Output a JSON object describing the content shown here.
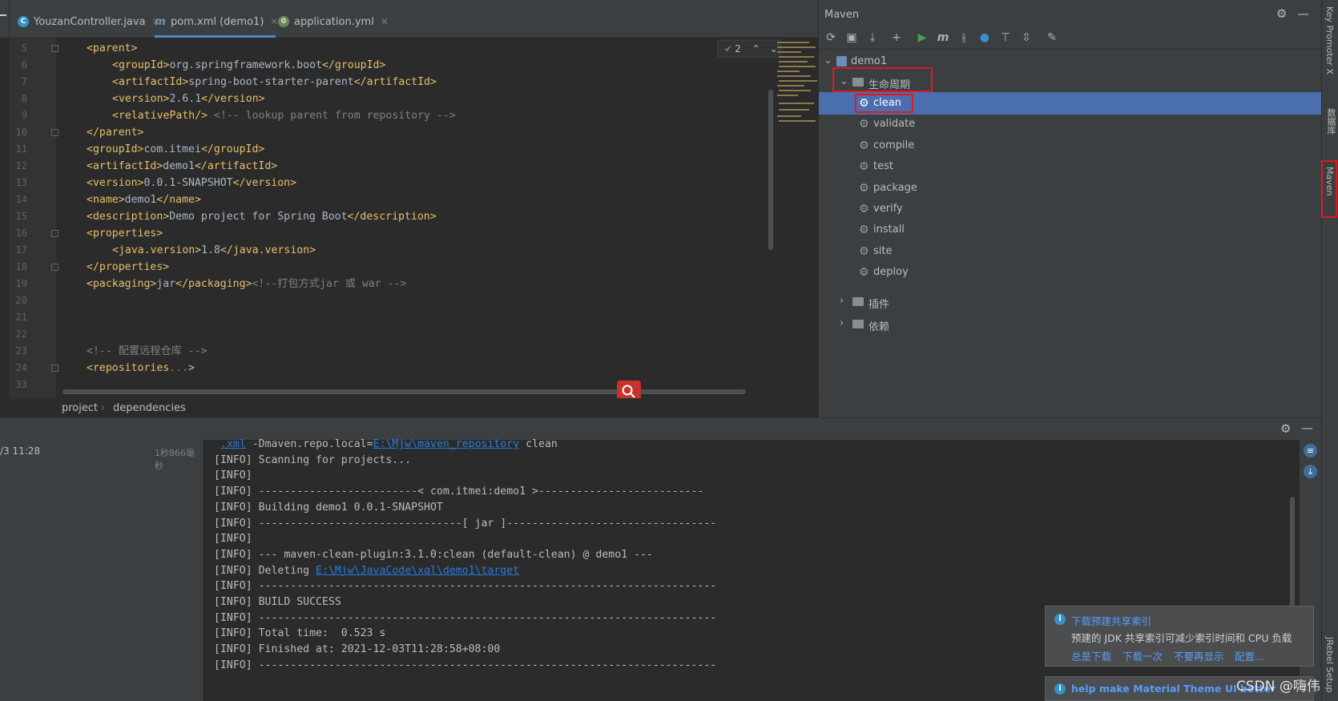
{
  "tabs": [
    {
      "label": "YouzanController.java",
      "icon": "class-icon"
    },
    {
      "label": "pom.xml (demo1)",
      "icon": "maven-file-icon"
    },
    {
      "label": "application.yml",
      "icon": "yaml-icon"
    }
  ],
  "editor": {
    "inspection_count": "2",
    "lines": [
      {
        "num": "5",
        "indent": 0,
        "parts": [
          [
            "tag",
            "<parent>"
          ]
        ]
      },
      {
        "num": "6",
        "indent": 1,
        "parts": [
          [
            "tag",
            "<groupId>"
          ],
          [
            "txt",
            "org.springframework.boot"
          ],
          [
            "tag",
            "</groupId>"
          ]
        ]
      },
      {
        "num": "7",
        "indent": 1,
        "parts": [
          [
            "tag",
            "<artifactId>"
          ],
          [
            "txt",
            "spring-boot-starter-parent"
          ],
          [
            "tag",
            "</artifactId>"
          ]
        ]
      },
      {
        "num": "8",
        "indent": 1,
        "parts": [
          [
            "tag",
            "<version>"
          ],
          [
            "txt",
            "2.6.1"
          ],
          [
            "tag",
            "</version>"
          ]
        ]
      },
      {
        "num": "9",
        "indent": 1,
        "parts": [
          [
            "tag",
            "<relativePath/>"
          ],
          [
            "cmt",
            " <!-- lookup parent from repository -->"
          ]
        ]
      },
      {
        "num": "10",
        "indent": 0,
        "parts": [
          [
            "tag",
            "</parent>"
          ]
        ]
      },
      {
        "num": "11",
        "indent": 0,
        "parts": [
          [
            "tag",
            "<groupId>"
          ],
          [
            "txt",
            "com.itmei"
          ],
          [
            "tag",
            "</groupId>"
          ]
        ]
      },
      {
        "num": "12",
        "indent": 0,
        "parts": [
          [
            "tag",
            "<artifactId>"
          ],
          [
            "txt",
            "demo1"
          ],
          [
            "tag",
            "</artifactId>"
          ]
        ]
      },
      {
        "num": "13",
        "indent": 0,
        "parts": [
          [
            "tag",
            "<version>"
          ],
          [
            "txt",
            "0.0.1-SNAPSHOT"
          ],
          [
            "tag",
            "</version>"
          ]
        ]
      },
      {
        "num": "14",
        "indent": 0,
        "parts": [
          [
            "tag",
            "<name>"
          ],
          [
            "txt",
            "demo1"
          ],
          [
            "tag",
            "</name>"
          ]
        ]
      },
      {
        "num": "15",
        "indent": 0,
        "parts": [
          [
            "tag",
            "<description>"
          ],
          [
            "txt",
            "Demo project for Spring Boot"
          ],
          [
            "tag",
            "</description>"
          ]
        ]
      },
      {
        "num": "16",
        "indent": 0,
        "parts": [
          [
            "tag",
            "<properties>"
          ]
        ]
      },
      {
        "num": "17",
        "indent": 1,
        "parts": [
          [
            "tag",
            "<java.version>"
          ],
          [
            "txt",
            "1.8"
          ],
          [
            "tag",
            "</java.version>"
          ]
        ]
      },
      {
        "num": "18",
        "indent": 0,
        "parts": [
          [
            "tag",
            "</properties>"
          ]
        ]
      },
      {
        "num": "19",
        "indent": 0,
        "parts": [
          [
            "tag",
            "<packaging>"
          ],
          [
            "txt",
            "jar"
          ],
          [
            "tag",
            "</packaging>"
          ],
          [
            "cmt",
            "<!--打包方式jar 或 war -->"
          ]
        ]
      },
      {
        "num": "20",
        "indent": 0,
        "parts": []
      },
      {
        "num": "21",
        "indent": 0,
        "parts": []
      },
      {
        "num": "22",
        "indent": 0,
        "parts": []
      },
      {
        "num": "23",
        "indent": 0,
        "parts": [
          [
            "cmt",
            "<!-- 配置远程仓库 -->"
          ]
        ]
      },
      {
        "num": "24",
        "indent": 0,
        "parts": [
          [
            "tag",
            "<repositories"
          ],
          [
            "cmt",
            "..."
          ],
          [
            "tag",
            ">"
          ]
        ]
      },
      {
        "num": "33",
        "indent": 0,
        "parts": []
      }
    ]
  },
  "breadcrumb": [
    "project",
    "dependencies"
  ],
  "maven": {
    "title": "Maven",
    "project": "demo1",
    "lifecycle_label": "生命周期",
    "goals": [
      "clean",
      "validate",
      "compile",
      "test",
      "package",
      "verify",
      "install",
      "site",
      "deploy"
    ],
    "selected_goal": "clean",
    "plugins_label": "插件",
    "dependencies_label": "依赖"
  },
  "side_strip": {
    "key_promoter": "Key Promoter X",
    "database": "数据库",
    "maven": "Maven",
    "jrebel": "JRebel Setup"
  },
  "run": {
    "time": "/3 11:28",
    "duration": "1秒866毫秒",
    "console": [
      {
        "type": "cmd",
        "link": ".xml",
        "rest": " -Dmaven.repo.local=",
        "link2": "E:\\Mjw\\maven_repository",
        "rest2": " clean"
      },
      {
        "type": "text",
        "text": "[INFO] Scanning for projects..."
      },
      {
        "type": "text",
        "text": "[INFO]"
      },
      {
        "type": "text",
        "text": "[INFO] -------------------------< com.itmei:demo1 >--------------------------"
      },
      {
        "type": "text",
        "text": "[INFO] Building demo1 0.0.1-SNAPSHOT"
      },
      {
        "type": "text",
        "text": "[INFO] --------------------------------[ jar ]---------------------------------"
      },
      {
        "type": "text",
        "text": "[INFO]"
      },
      {
        "type": "text",
        "text": "[INFO] --- maven-clean-plugin:3.1.0:clean (default-clean) @ demo1 ---"
      },
      {
        "type": "del",
        "text": "[INFO] Deleting ",
        "link": "E:\\Mjw\\JavaCode\\xql\\demo1\\target"
      },
      {
        "type": "text",
        "text": "[INFO] ------------------------------------------------------------------------"
      },
      {
        "type": "text",
        "text": "[INFO] BUILD SUCCESS"
      },
      {
        "type": "text",
        "text": "[INFO] ------------------------------------------------------------------------"
      },
      {
        "type": "text",
        "text": "[INFO] Total time:  0.523 s"
      },
      {
        "type": "text",
        "text": "[INFO] Finished at: 2021-12-03T11:28:58+08:00"
      },
      {
        "type": "text",
        "text": "[INFO] ------------------------------------------------------------------------"
      }
    ]
  },
  "notification1": {
    "title": "下载预建共享索引",
    "body": "预建的 JDK 共享索引可减少索引时间和 CPU 负载",
    "actions": [
      "总是下载",
      "下载一次",
      "不要再显示",
      "配置..."
    ]
  },
  "notification2": {
    "title": "help make Material Theme UI better"
  },
  "watermark": "CSDN @嗨伟",
  "colors": {
    "accent": "#4b6eaf",
    "highlight": "#e0191e",
    "tag": "#e8bf6a",
    "comment": "#808080",
    "link": "#287bde"
  }
}
